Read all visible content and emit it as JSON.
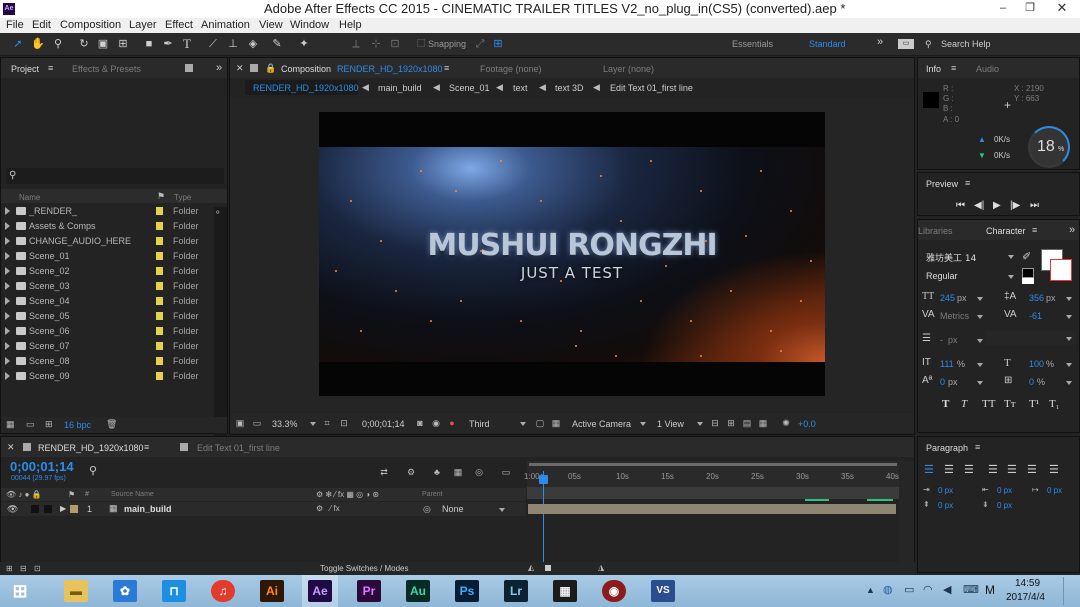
{
  "window": {
    "title": "Adobe After Effects CC 2015 - CINEMATIC TRAILER TITLES V2_no_plug_in(CS5) (converted).aep *",
    "app_icon": "Ae"
  },
  "menu": [
    "File",
    "Edit",
    "Composition",
    "Layer",
    "Effect",
    "Animation",
    "View",
    "Window",
    "Help"
  ],
  "toolbar": {
    "snapping": "Snapping",
    "workspaces": [
      "Essentials",
      "Standard"
    ],
    "search_help": "Search Help"
  },
  "project_panel": {
    "tabs": [
      "Project",
      "Effects & Presets"
    ],
    "columns": {
      "name": "Name",
      "type": "Type"
    },
    "items": [
      {
        "name": "_RENDER_",
        "type": "Folder"
      },
      {
        "name": "Assets & Comps",
        "type": "Folder"
      },
      {
        "name": "CHANGE_AUDIO_HERE",
        "type": "Folder"
      },
      {
        "name": "Scene_01",
        "type": "Folder"
      },
      {
        "name": "Scene_02",
        "type": "Folder"
      },
      {
        "name": "Scene_03",
        "type": "Folder"
      },
      {
        "name": "Scene_04",
        "type": "Folder"
      },
      {
        "name": "Scene_05",
        "type": "Folder"
      },
      {
        "name": "Scene_06",
        "type": "Folder"
      },
      {
        "name": "Scene_07",
        "type": "Folder"
      },
      {
        "name": "Scene_08",
        "type": "Folder"
      },
      {
        "name": "Scene_09",
        "type": "Folder"
      }
    ],
    "bpc": "16 bpc"
  },
  "comp_panel": {
    "tab_prefix": "Composition",
    "tab_name": "RENDER_HD_1920x1080",
    "footage_tab": "Footage (none)",
    "layer_tab": "Layer (none)",
    "breadcrumbs": [
      "RENDER_HD_1920x1080",
      "main_build",
      "Scene_01",
      "text",
      "text 3D",
      "Edit Text 01_first line"
    ],
    "title_text": "MUSHUI RONGZHI",
    "subtitle_text": "JUST A TEST",
    "zoom": "33.3%",
    "timecode": "0;00;01;14",
    "resolution": "Third",
    "camera": "Active Camera",
    "views": "1 View",
    "exposure": "+0.0"
  },
  "info_panel": {
    "tabs": [
      "Info",
      "Audio"
    ],
    "r": "R :",
    "g": "G :",
    "b": "B :",
    "a": "A : 0",
    "x": "X : 2190",
    "y": "Y : 663",
    "net_up": "0K/s",
    "net_down": "0K/s",
    "percent": "18",
    "percent_sign": "%"
  },
  "preview_panel": {
    "title": "Preview"
  },
  "character_panel": {
    "tabs": [
      "Libraries",
      "Character"
    ],
    "font": "雅坊美工 14",
    "style": "Regular",
    "font_size": "245",
    "font_size_unit": "px",
    "leading": "356",
    "leading_unit": "px",
    "kerning": "Metrics",
    "tracking": "-61",
    "stroke_width": "-",
    "stroke_unit": "px",
    "vscale": "111",
    "vscale_unit": "%",
    "hscale": "100",
    "hscale_unit": "%",
    "baseline": "0",
    "baseline_unit": "px",
    "tsume": "0",
    "tsume_unit": "%",
    "styles": [
      "T",
      "T",
      "TT",
      "Tт",
      "T¹",
      "T₁"
    ]
  },
  "paragraph_panel": {
    "title": "Paragraph",
    "values": [
      "0 px",
      "0 px",
      "0 px",
      "0 px",
      "0 px"
    ]
  },
  "timeline": {
    "tabs": [
      "RENDER_HD_1920x1080",
      "Edit Text 01_first line"
    ],
    "timecode": "0;00;01;14",
    "frames": "00044 (29.97 fps)",
    "columns": {
      "source": "Source Name",
      "parent": "Parent"
    },
    "layer": {
      "index": "1",
      "name": "main_build",
      "parent": "None"
    },
    "ruler": [
      "1:00s",
      "05s",
      "10s",
      "15s",
      "20s",
      "25s",
      "30s",
      "35s",
      "40s"
    ],
    "toggle": "Toggle Switches / Modes"
  },
  "taskbar": {
    "apps": [
      "Ai",
      "Ae",
      "Pr",
      "Au",
      "Ps",
      "Lr"
    ],
    "time": "14:59",
    "date": "2017/4/4",
    "ime": "M"
  },
  "colors": {
    "accent": "#2d8ceb",
    "folder_label": "#e3d24a",
    "ae_icon": "#1f0a46"
  }
}
